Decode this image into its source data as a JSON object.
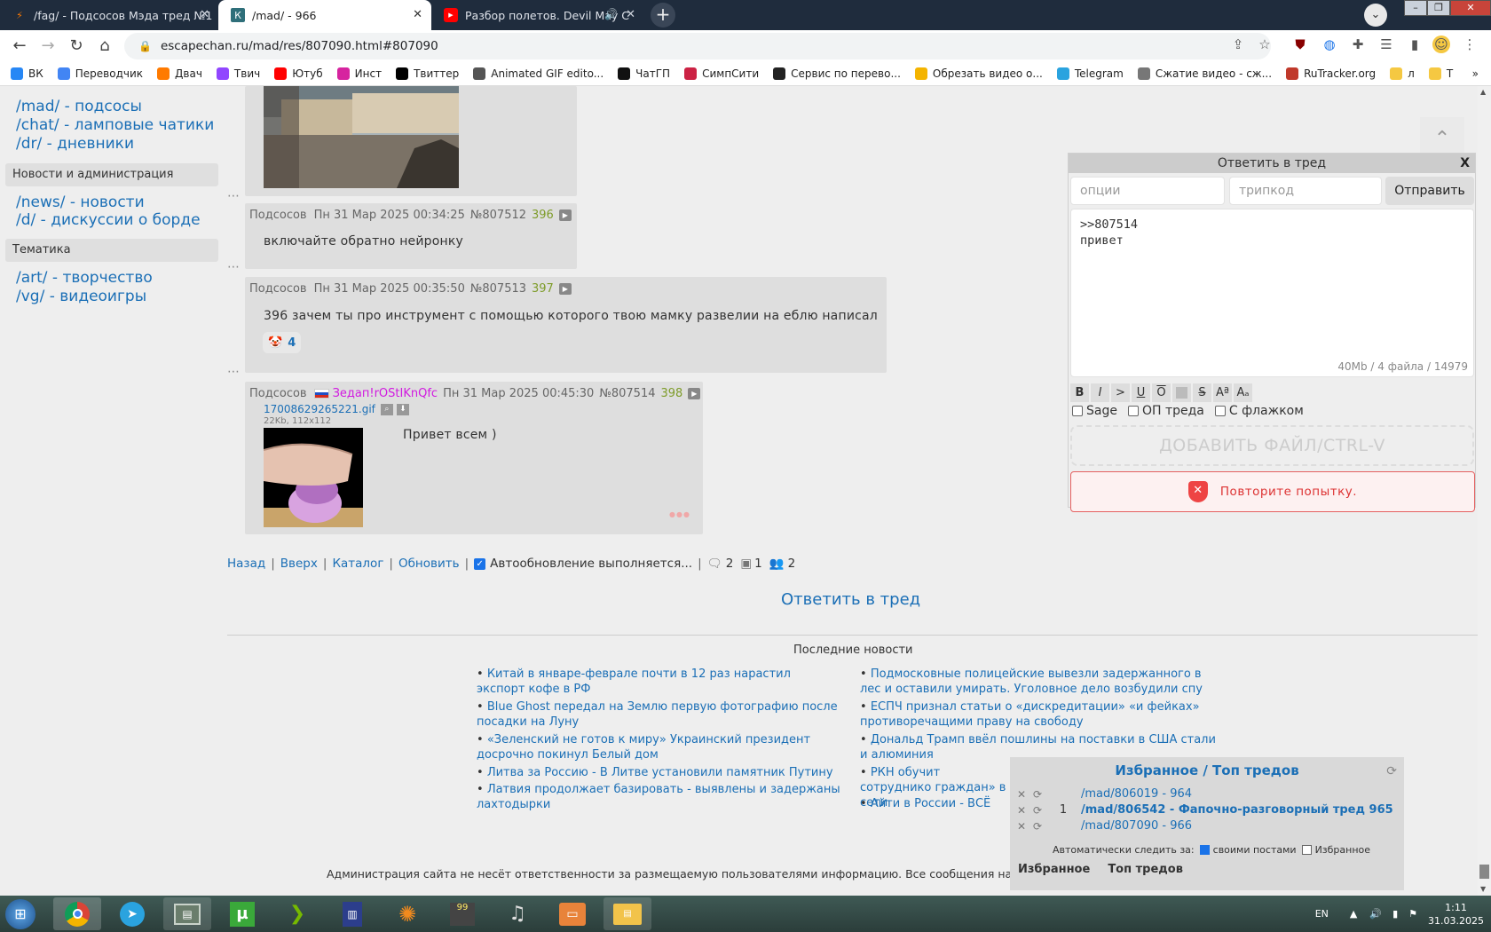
{
  "browser": {
    "tabs": [
      {
        "title": "/fag/ - Подсосов Мэда тред №1",
        "icon": "bolt-icon",
        "active": false
      },
      {
        "title": "/mad/ - 966",
        "icon": "site-logo-icon",
        "active": true
      },
      {
        "title": "Разбор полетов. Devil May C",
        "icon": "youtube-icon",
        "active": false
      }
    ],
    "url": "escapechan.ru/mad/res/807090.html#807090",
    "bookmarks": [
      {
        "label": "ВК",
        "icon": "vk-icon",
        "color": "#2787f5"
      },
      {
        "label": "Переводчик",
        "icon": "translate-icon",
        "color": "#4285f4"
      },
      {
        "label": "Двач",
        "icon": "bolt-icon",
        "color": "#ff7a00"
      },
      {
        "label": "Твич",
        "icon": "twitch-icon",
        "color": "#9146ff"
      },
      {
        "label": "Ютуб",
        "icon": "youtube-icon",
        "color": "#ff0000"
      },
      {
        "label": "Инст",
        "icon": "instagram-icon",
        "color": "#d6249f"
      },
      {
        "label": "Твиттер",
        "icon": "x-icon",
        "color": "#000000"
      },
      {
        "label": "Animated GIF edito...",
        "icon": "gif-icon",
        "color": "#555555"
      },
      {
        "label": "ЧатГП",
        "icon": "openai-icon",
        "color": "#111111"
      },
      {
        "label": "СимпСити",
        "icon": "simpcity-icon",
        "color": "#cc2244"
      },
      {
        "label": "Сервис по перево...",
        "icon": "arrow-icon",
        "color": "#222222"
      },
      {
        "label": "Обрезать видео о...",
        "icon": "dots-icon",
        "color": "#f4b400"
      },
      {
        "label": "Telegram",
        "icon": "telegram-icon",
        "color": "#2aa3df"
      },
      {
        "label": "Сжатие видео - сж...",
        "icon": "compress-icon",
        "color": "#777777"
      },
      {
        "label": "RuTracker.org",
        "icon": "rutracker-icon",
        "color": "#c0392b"
      },
      {
        "label": "л",
        "icon": "folder-icon",
        "color": "#f5c842"
      },
      {
        "label": "Т",
        "icon": "folder-icon",
        "color": "#f5c842"
      }
    ]
  },
  "sidebar": {
    "boards_top": [
      "/mad/ - подсосы",
      "/chat/ - ламповые чатики",
      "/dr/ - дневники"
    ],
    "section_news": "Новости и администрация",
    "boards_news": [
      "/news/ - новости",
      "/d/ - дискуссии о борде"
    ],
    "section_topics": "Тематика",
    "boards_topics": [
      "/art/ - творчество",
      "/vg/ - видеоигры"
    ]
  },
  "posts": [
    {
      "name": "Подсосов",
      "date": "Пн 31 Мар 2025 00:34:25",
      "no": "№807512",
      "count": "396",
      "text": "включайте обратно нейронку"
    },
    {
      "name": "Подсосов",
      "date": "Пн 31 Мар 2025 00:35:50",
      "no": "№807513",
      "count": "397",
      "text": "396 зачем ты про инструмент с помощью которого твою мамку развелии на еблю написал",
      "reaction_count": "4"
    },
    {
      "name": "Подсосов",
      "trip": "Зедап!rOStIKnQfc",
      "date": "Пн 31 Мар 2025 00:45:30",
      "no": "№807514",
      "count": "398",
      "file_name": "17008629265221.gif",
      "file_meta": "22Kb, 112x112",
      "text": "Привет всем )"
    }
  ],
  "bottom_nav": {
    "back": "Назад",
    "up": "Вверх",
    "catalog": "Каталог",
    "refresh": "Обновить",
    "autoupdate": "Автообновление выполняется...",
    "posts_count": "2",
    "files_count": "1",
    "users_count": "2",
    "reply_link": "Ответить в тред"
  },
  "news": {
    "title": "Последние новости",
    "left": [
      "Китай в январе-феврале почти в 12 раз нарастил экспорт кофе в РФ",
      "Blue Ghost передал на Землю первую фотографию после посадки на Луну",
      "«Зеленский не готов к миру» Украинский президент досрочно покинул Белый дом",
      "Литва за Россию - В Литве установили памятник Путину",
      "Латвия продолжает базировать - выявлены и задержаны лахтодырки"
    ],
    "right": [
      "Подмосковные полицейские вывезли задержанного в лес и оставили умирать. Уголовное дело возбудили спу",
      "ЕСПЧ признал статьи о «дискредитации» «и фейках» противоречащими праву на свободу",
      "Дональд Трамп ввёл пошлины на поставки в США стали и алюминия",
      "РКН обучит сотруднико граждан» в сети",
      "Айти в России - ВСЁ"
    ]
  },
  "disclaimer": "Администрация сайта не несёт ответственности за размещаемую пользователями информацию. Все сообщения на сайте п",
  "reply_form": {
    "title": "Ответить в тред",
    "close": "X",
    "options_placeholder": "опции",
    "tripcode_placeholder": "трипкод",
    "send": "Отправить",
    "message": ">>807514\nпривет",
    "limit": "40Mb / 4 файла / 14979",
    "markup": [
      "B",
      "I",
      ">",
      "U",
      "O",
      "",
      "S",
      "Aª",
      "Aₐ"
    ],
    "sage": "Sage",
    "op": "ОП треда",
    "flag": "С флажком",
    "add_file": "ДОБАВИТЬ ФАЙЛ/CTRL-V",
    "error": "Повторите попытку."
  },
  "favorites": {
    "title": "Избранное / Топ тредов",
    "rows": [
      {
        "count": "",
        "link": "/mad/806019 - 964",
        "bold": false
      },
      {
        "count": "1",
        "link": "/mad/806542 - Фапочно-разговорный тред 965",
        "bold": true
      },
      {
        "count": "",
        "link": "/mad/807090 - 966",
        "bold": false
      }
    ],
    "auto_label": "Автоматически следить за:",
    "own_posts": "своими постами",
    "favorites_opt": "Избранное",
    "tab_fav": "Избранное",
    "tab_top": "Топ тредов"
  },
  "taskbar": {
    "lang": "EN",
    "time": "1:11",
    "date": "31.03.2025"
  },
  "colors": {
    "link": "#1b6fb6",
    "post_bg": "#dedede",
    "page_bg": "#eeeeee",
    "error": "#dd3333"
  }
}
